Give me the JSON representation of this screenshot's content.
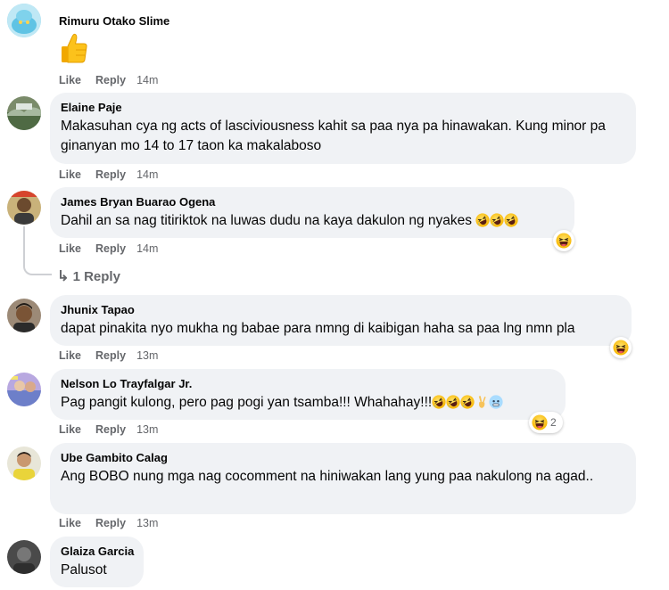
{
  "actions": {
    "like": "Like",
    "reply": "Reply"
  },
  "comments": [
    {
      "name": "Rimuru Otako Slime",
      "text": "",
      "time": "14m",
      "sticker": "thumbs-up-emoji"
    },
    {
      "name": "Elaine Paje",
      "text": "Makasuhan cya ng acts of lasciviousness kahit sa paa nya pa hinawakan. Kung minor pa ginanyan mo 14 to 17 taon ka makalaboso",
      "time": "14m"
    },
    {
      "name": "James Bryan Buarao Ogena",
      "text": "Dahil an sa nag titiriktok na luwas dudu na kaya dakulon ng nyakes",
      "time": "14m",
      "reaction": "haha",
      "replies": "1 Reply"
    },
    {
      "name": "Jhunix Tapao",
      "text": "dapat pinakita nyo mukha ng babae para nmng di kaibigan haha sa paa lng nmn pla",
      "time": "13m",
      "reaction": "haha"
    },
    {
      "name": "Nelson Lo Trayfalgar Jr.",
      "text": "Pag pangit kulong, pero pag pogi yan tsamba!!! Whahahay!!!",
      "time": "13m",
      "reaction": "haha",
      "reaction_count": "2"
    },
    {
      "name": "Ube Gambito Calag",
      "text": "Ang BOBO nung mga nag cocomment na hiniwakan lang yung paa nakulong na agad..",
      "time": "13m"
    },
    {
      "name": "Glaiza Garcia",
      "text": "Palusot"
    }
  ]
}
